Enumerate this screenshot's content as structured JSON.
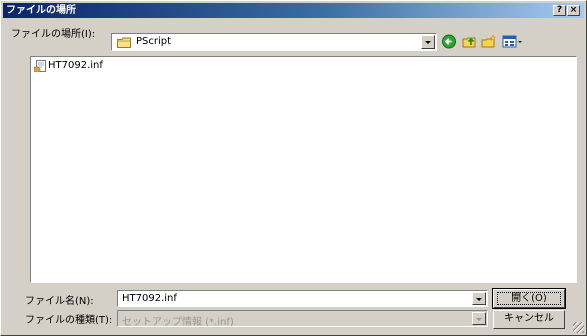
{
  "window": {
    "title": "ファイルの場所",
    "help_button": "?",
    "close_button": "×"
  },
  "look_in": {
    "label": "ファイルの場所(I):",
    "value": "PScript"
  },
  "toolbar": {
    "back_icon": "green-back-arrow-icon",
    "up_icon": "up-folder-icon",
    "new_folder_icon": "new-folder-icon",
    "view_icon": "view-menu-icon"
  },
  "files": [
    {
      "name": "HT7092.inf",
      "icon": "setup-file-icon"
    }
  ],
  "filename": {
    "label": "ファイル名(N):",
    "value": "HT7092.inf"
  },
  "filetype": {
    "label": "ファイルの種類(T):",
    "value": "セットアップ情報 (*.inf)"
  },
  "buttons": {
    "open": "開く(O)",
    "cancel": "キャンセル"
  },
  "colors": {
    "title_start": "#0a246a",
    "title_end": "#a6caf0",
    "face": "#d4d0c8"
  }
}
